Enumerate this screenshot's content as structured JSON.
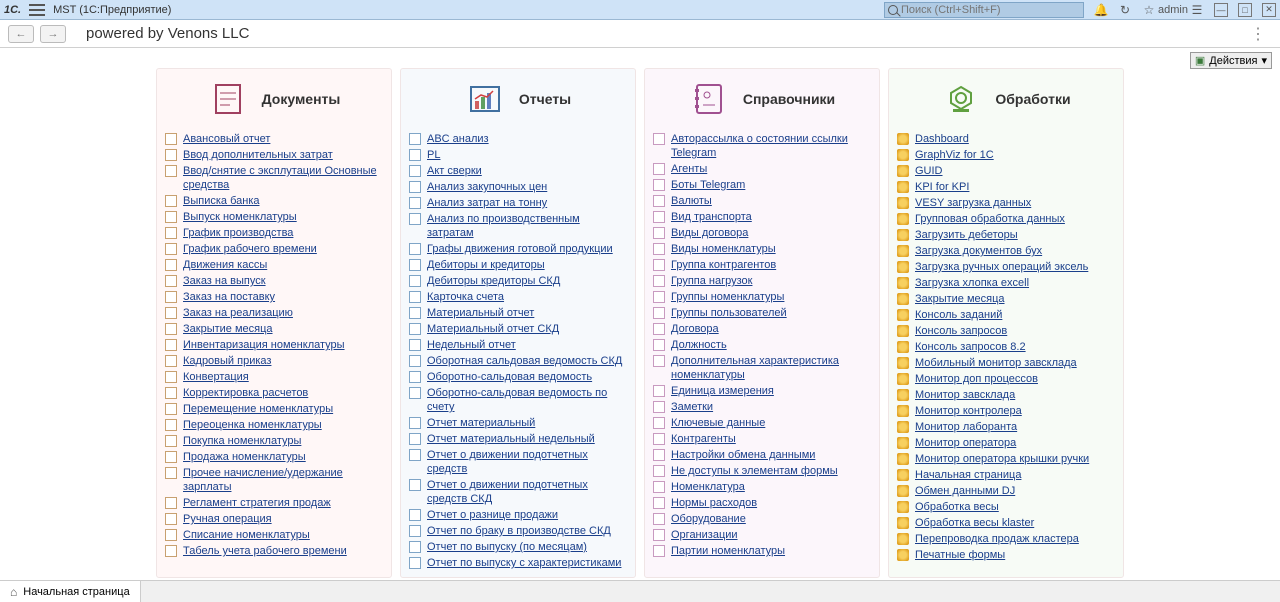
{
  "header": {
    "logo": "1C.",
    "app_title": "MST  (1С:Предприятие)",
    "search_placeholder": "Поиск (Ctrl+Shift+F)",
    "user": "admin"
  },
  "nav": {
    "page_title": "powered by Venons LLC",
    "actions_label": "Действия"
  },
  "bottom": {
    "tab_home": "Начальная страница"
  },
  "panels": [
    {
      "title": "Документы",
      "items": [
        "Авансовый отчет",
        "Ввод дополнительных затрат",
        "Ввод/снятие с эксплутации Основные средства",
        "Выписка банка",
        "Выпуск номенклатуры",
        "График производства",
        "График рабочего времени",
        "Движения кассы",
        "Заказ на выпуск",
        "Заказ на поставку",
        "Заказ на реализацию",
        "Закрытие месяца",
        "Инвентаризация номенклатуры",
        "Кадровый приказ",
        "Конвертация",
        "Корректировка расчетов",
        "Перемещение номенклатуры",
        "Переоценка номенклатуры",
        "Покупка номенклатуры",
        "Продажа номенклатуры",
        "Прочее начисление/удержание зарплаты",
        "Регламент стратегия продаж",
        "Ручная операция",
        "Списание номенклатуры",
        "Табель учета рабочего времени"
      ]
    },
    {
      "title": "Отчеты",
      "items": [
        "ABC анализ",
        "PL",
        "Акт сверки",
        "Анализ закупочных цен",
        "Анализ затрат на тонну",
        "Анализ по производственным затратам",
        "Графы движения готовой продукции",
        "Дебиторы и кредиторы",
        "Дебиторы кредиторы СКД",
        "Карточка счета",
        "Материальный отчет",
        "Материальный отчет СКД",
        "Недельный отчет",
        "Оборотная сальдовая ведомость СКД",
        "Оборотно-сальдовая ведомость",
        "Оборотно-сальдовая ведомость по счету",
        "Отчет материальный",
        "Отчет материальный недельный",
        "Отчет о движении подотчетных средств",
        "Отчет о движении подотчетных средств СКД",
        "Отчет о разнице продажи",
        "Отчет по браку в производстве СКД",
        "Отчет по выпуску (по месяцам)",
        "Отчет по выпуску с характеристиками"
      ]
    },
    {
      "title": "Справочники",
      "items": [
        "Авторассылка о состоянии ссылки Telegram",
        "Агенты",
        "Боты Telegram",
        "Валюты",
        "Вид транспорта",
        "Виды договора",
        "Виды номенклатуры",
        "Группа контрагентов",
        "Группа нагрузок",
        "Группы номенклатуры",
        "Группы пользователей",
        "Договора",
        "Должность",
        "Дополнительная характеристика номенклатуры",
        "Единица измерения",
        "Заметки",
        "Ключевые данные",
        "Контрагенты",
        "Настройки обмена данными",
        "Не доступы к элементам формы",
        "Номенклатура",
        "Нормы расходов",
        "Оборудование",
        "Организации",
        "Партии номенклатуры"
      ]
    },
    {
      "title": "Обработки",
      "items": [
        "Dashboard",
        "GraphViz for 1C",
        "GUID",
        "KPI for KPI",
        "VESY загрузка данных",
        "Групповая обработка данных",
        "Загрузить дебеторы",
        "Загрузка документов бух",
        "Загрузка ручных операций эксель",
        "Загрузка хлопка excell",
        "Закрытие месяца",
        "Консоль заданий",
        "Консоль запросов",
        "Консоль запросов 8.2",
        "Мобильный монитор завсклада",
        "Монитор доп процессов",
        "Монитор завсклада",
        "Монитор контролера",
        "Монитор лаборанта",
        "Монитор оператора",
        "Монитор оператора крышки ручки",
        "Начальная страница",
        "Обмен данными DJ",
        "Обработка весы",
        "Обработка весы klaster",
        "Перепроводка продаж кластера",
        "Печатные формы"
      ]
    }
  ]
}
